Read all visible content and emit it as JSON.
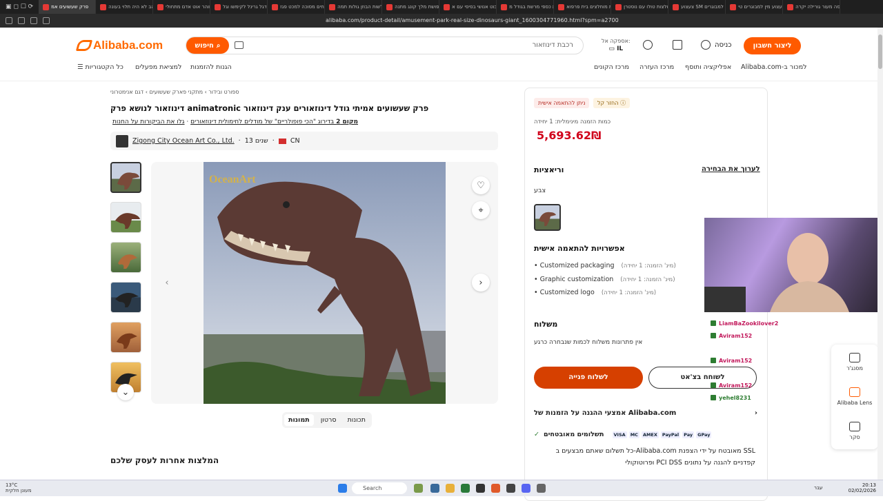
{
  "browser": {
    "tabs": [
      {
        "label": "פרק שעשועים אמ",
        "active": true
      },
      {
        "label": "הזהב לא היה תלוי בעונה"
      },
      {
        "label": "דגל זוהר אוט אדם מתחולי"
      },
      {
        "label": "דגל גרינל לקימשו וגל"
      },
      {
        "label": "מנוחים מסוכה למכט פגז"
      },
      {
        "label": "מטלשות הבוזן גולות תמה"
      },
      {
        "label": "תחפושת מלך קונג מתנה"
      },
      {
        "label": "רובוט אנושי בסיסי עם א"
      },
      {
        "label": "בית כספי מרשת בגודל מ"
      },
      {
        "label": "בית מוחלצים בית פרפוא"
      },
      {
        "label": "חולצות טולו עם נוסטרן"
      },
      {
        "label": "צעצוע SM למבוגרים"
      },
      {
        "label": "צעצוע מין למבוגרים טי"
      },
      {
        "label": "סוסה מעור גורילה יקרה"
      }
    ],
    "url": "alibaba.com/product-detail/amusement-park-real-size-dinosaurs-giant_1600304771960.html?spm=a2700.7724857.0.0.45d13cb8xPNkl"
  },
  "header": {
    "logo": "Alibaba.com",
    "search_button": "חיפוש",
    "search_placeholder": "רכבת דינוזאור",
    "ship_to_label": "אספקה אל:",
    "ship_to_value": "IL",
    "login": "כניסה",
    "signup": "ליצור חשבון",
    "nav_left": [
      "כל הקטגוריות",
      "למציאת מפעלים",
      "הגנות להזמנות"
    ],
    "nav_right": [
      "מרכז הקונים",
      "מרכז העזרה",
      "אפליקציה ותוסף",
      "Alibaba.com-למכור ב"
    ]
  },
  "product": {
    "breadcrumb": "ספורט ובידור › מתקני פארק שעשועים › דגם אנימטרוני",
    "title": "דינוזאור לנושא פרק animatronic פרק שעשועים אמיתי גודל דינוזאורים ענק דינוזאור",
    "rank_text": "מקום 2",
    "rank_rest": " בדירוג \"הכי פופולריים\" של מודלים לחימולית דינוזאורים",
    "rank_link": "גלו את הביקורות על החנות",
    "seller_name": "Zigong City Ocean Art Co., Ltd.",
    "seller_years": "שנים 13",
    "seller_country": "CN",
    "image_watermark": "OceanArt",
    "media_tabs": [
      "תמונות",
      "סרטון",
      "תכונות"
    ],
    "recs_title": "המלצות אחרות לעסק שלכם"
  },
  "panel": {
    "badge1": "ניתן להתאמה אישית",
    "badge2": "החזר קל",
    "min_order": "כמות הזמנה מינימלית: 1 יחידה",
    "price": "5,693.62₪",
    "variations": "וריאציות",
    "edit_selection": "לערוך את הבחירה",
    "color_label": "צבע",
    "custom_title": "אפשרויות להתאמה אישית",
    "custom_items": [
      {
        "name": "Customized packaging",
        "mo": "(מינ' הזמנה: 1 יחידה)"
      },
      {
        "name": "Graphic customization",
        "mo": "(מינ' הזמנה: 1 יחידה)"
      },
      {
        "name": "Customized logo",
        "mo": "(מינ' הזמנה: 1 יחידה)"
      }
    ],
    "shipping_title": "משלוח",
    "shipping_note": "אין פתרונות משלוח לכמות שנבחרה כרגע",
    "send_inquiry": "לשלוח פנייה",
    "chat_now": "לשוחח בצ'אט",
    "protection": "אמצעי ההגנה על הזמנות של Alibaba.com",
    "secure_payments": "תשלומים מאובטחים",
    "pay_logos": [
      "VISA",
      "MC",
      "AMEX",
      "PayPal",
      "Pay",
      "GPay"
    ],
    "ssl_text": "כל תשלום שאתם מבצעים ב-Alibaba.com מאובטח על ידי הצפנת SSL ופרוטוקולי PCI DSS קפדניים להגנה על נתונים"
  },
  "side": {
    "items": [
      "מסנג'ר",
      "Alibaba Lens",
      "סקר"
    ]
  },
  "chat_overlay": [
    {
      "user": "LiamBaZookilover2"
    },
    {
      "user": "Aviram152"
    },
    {
      "user": "Aviram152"
    },
    {
      "user": "Aviram152"
    },
    {
      "user": "yehel8231"
    }
  ],
  "taskbar": {
    "weather_temp": "13°C",
    "weather_desc": "מעונן חלקית",
    "search": "Search",
    "time": "20:13",
    "date": "02/02/2026",
    "lang": "עבר"
  },
  "colors": {
    "accent": "#ff5a00",
    "price": "#d0021b",
    "send": "#d64000"
  }
}
